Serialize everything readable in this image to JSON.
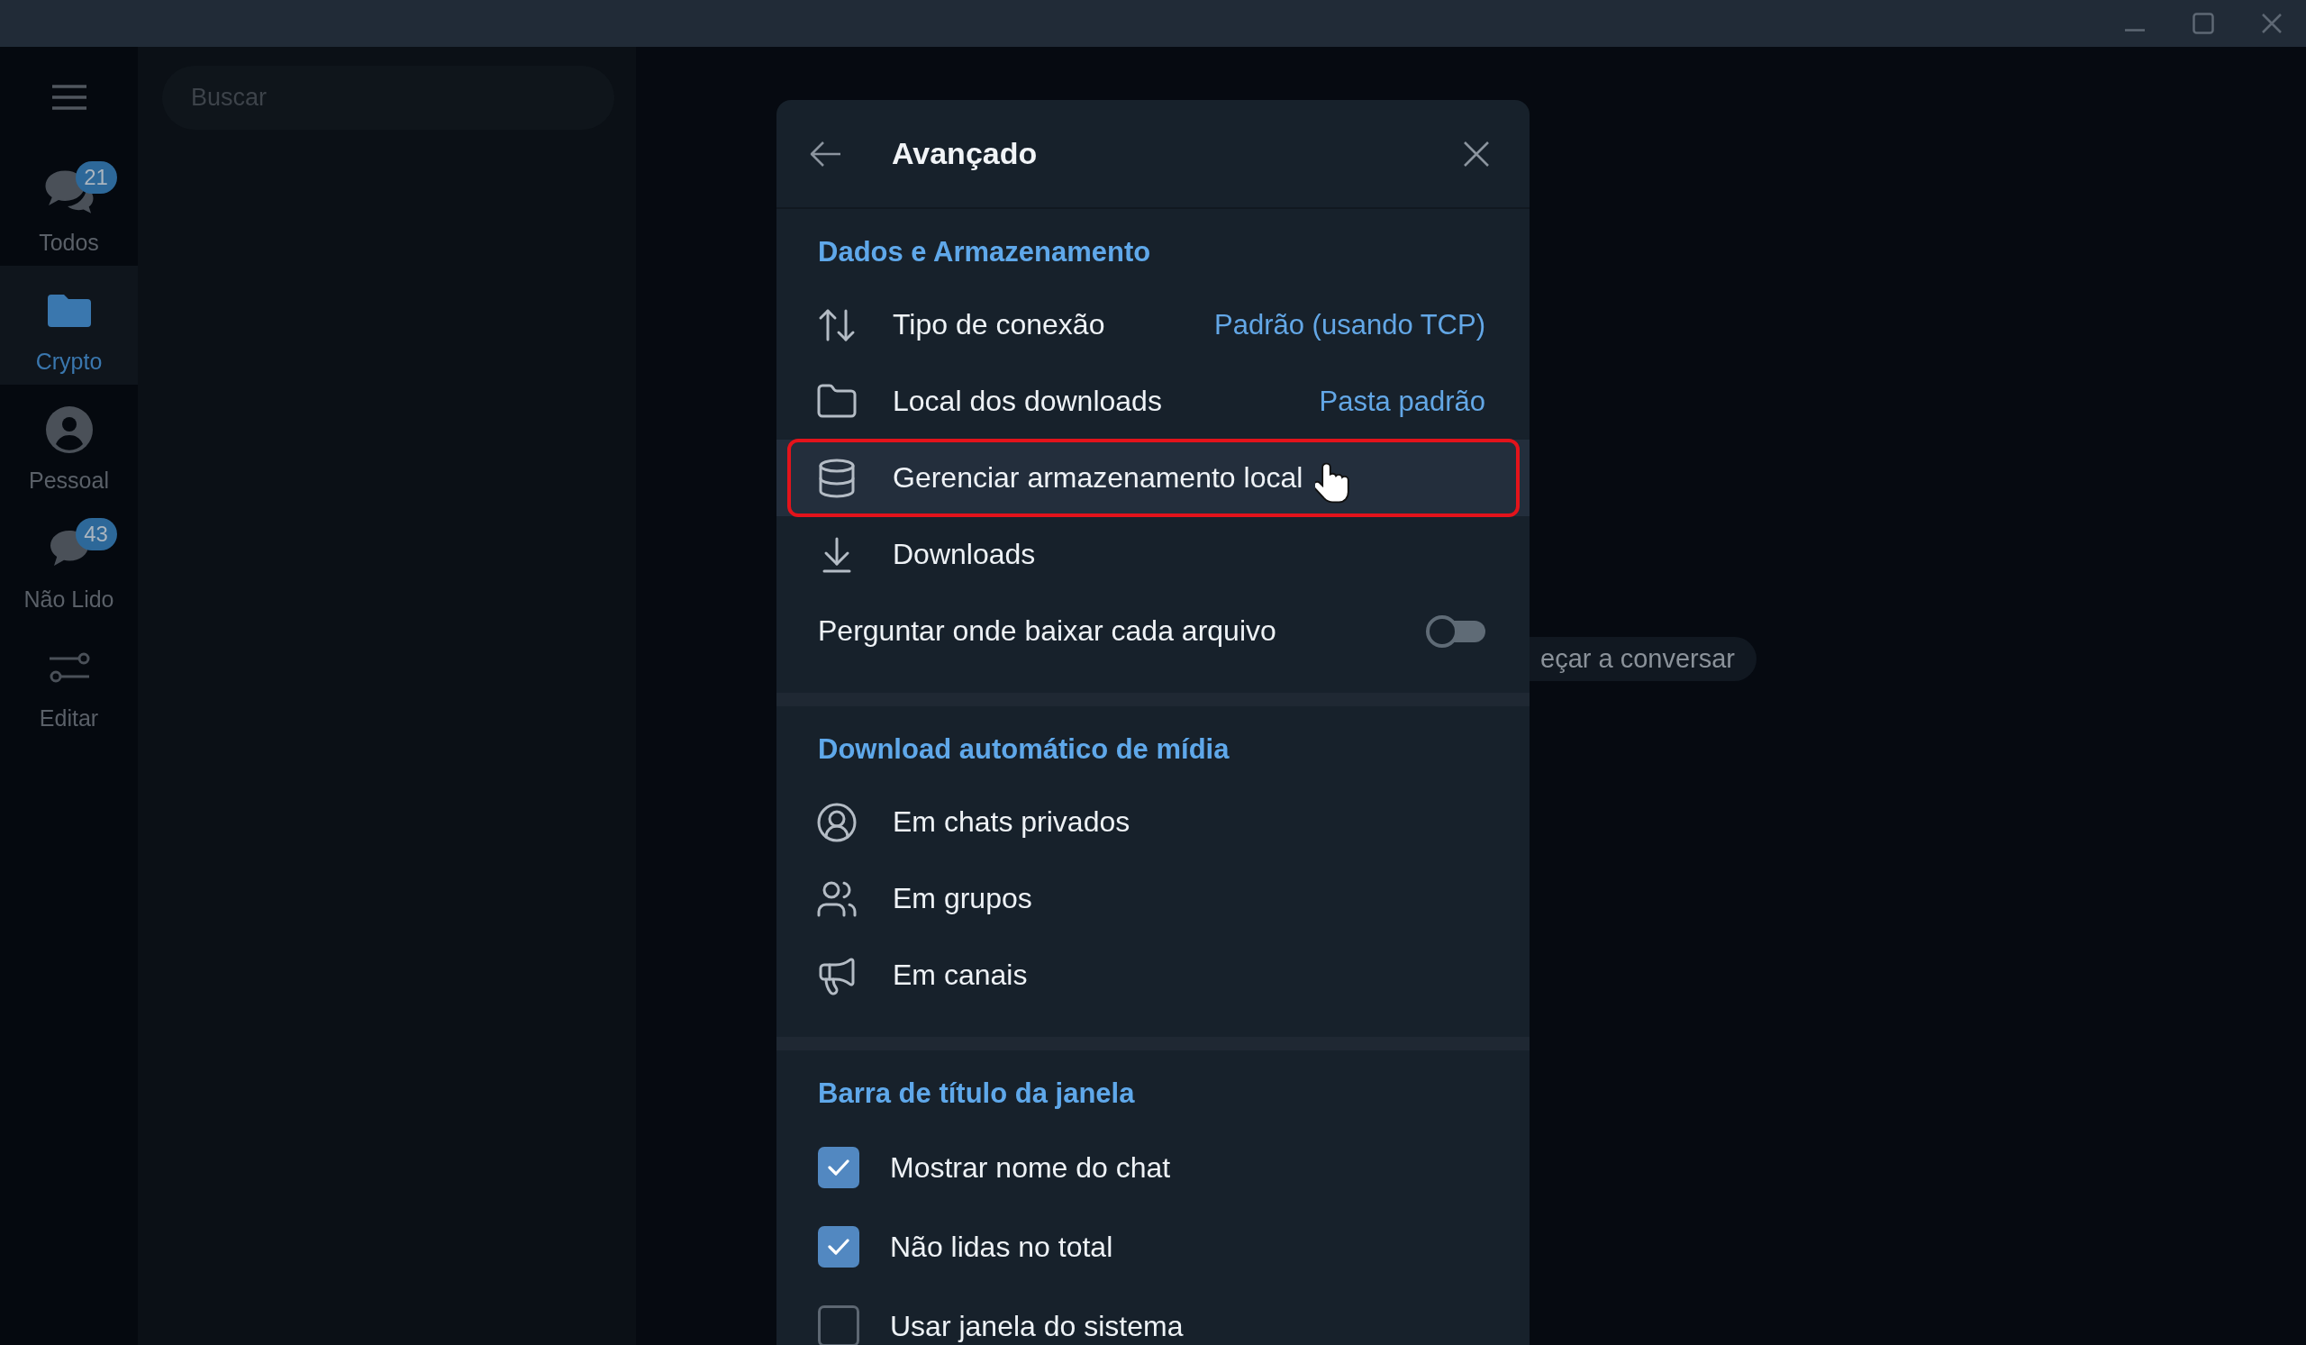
{
  "sidebar": {
    "folders": [
      {
        "kind": "chats",
        "label": "Todos",
        "badge": "21",
        "selected": false
      },
      {
        "kind": "folder",
        "label": "Crypto",
        "selected": true
      },
      {
        "kind": "person",
        "label": "Pessoal",
        "selected": false
      },
      {
        "kind": "chat",
        "label": "Não Lido",
        "badge": "43",
        "selected": false
      },
      {
        "kind": "edit",
        "label": "Editar",
        "selected": false
      }
    ]
  },
  "chat_list": {
    "search": {
      "placeholder": "Buscar"
    }
  },
  "main": {
    "hint": "eçar a conversar"
  },
  "dialog": {
    "title": "Avançado",
    "sections": [
      {
        "title": "Dados e Armazenamento",
        "rows": [
          {
            "kind": "value",
            "label": "Tipo de conexão",
            "value": "Padrão (usando TCP)",
            "highlighted": false
          },
          {
            "kind": "value",
            "label": "Local dos downloads",
            "value": "Pasta padrão",
            "highlighted": false
          },
          {
            "kind": "action",
            "label": "Gerenciar armazenamento local",
            "highlighted": true
          },
          {
            "kind": "action",
            "label": "Downloads",
            "highlighted": false
          },
          {
            "kind": "toggle",
            "label": "Perguntar onde baixar cada arquivo",
            "on": false,
            "highlighted": false
          }
        ]
      },
      {
        "title": "Download automático de mídia",
        "rows": [
          {
            "kind": "action",
            "label": "Em chats privados",
            "highlighted": false
          },
          {
            "kind": "action",
            "label": "Em grupos",
            "highlighted": false
          },
          {
            "kind": "action",
            "label": "Em canais",
            "highlighted": false
          }
        ]
      },
      {
        "title": "Barra de título da janela",
        "rows": [
          {
            "kind": "checkbox",
            "label": "Mostrar nome do chat",
            "checked": true,
            "highlighted": false
          },
          {
            "kind": "checkbox",
            "label": "Não lidas no total",
            "checked": true,
            "highlighted": false
          },
          {
            "kind": "checkbox",
            "label": "Usar janela do sistema",
            "checked": false,
            "highlighted": false
          }
        ]
      }
    ]
  }
}
